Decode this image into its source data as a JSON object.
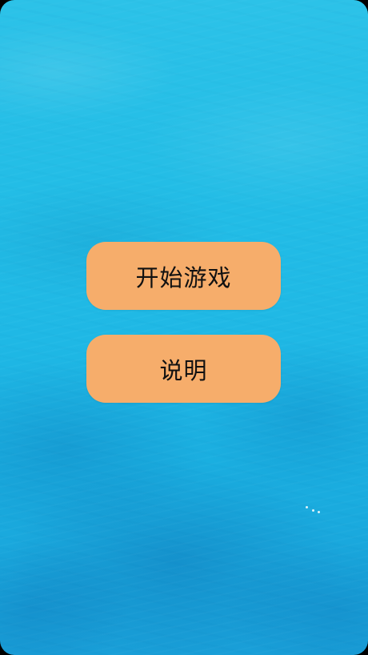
{
  "menu": {
    "start_label": "开始游戏",
    "help_label": "说明"
  },
  "colors": {
    "button_fill": "#f6ad6b",
    "water": "#23bde6"
  }
}
